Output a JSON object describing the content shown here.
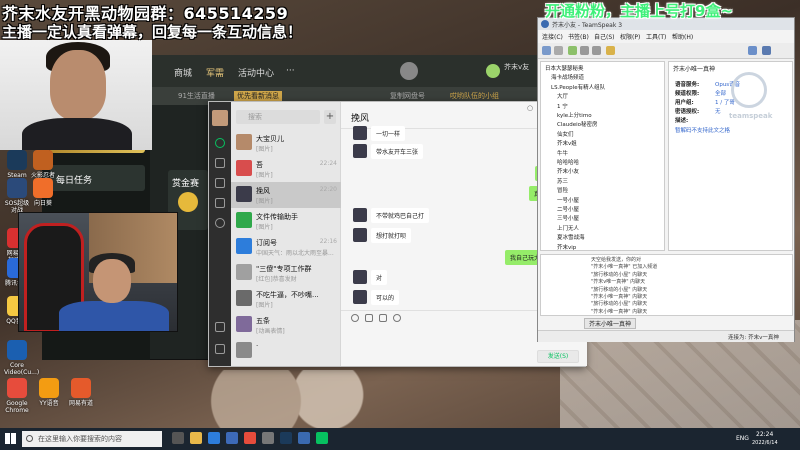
{
  "captions": {
    "top_left_1": "芥末水友开黑动物园群：645514259",
    "top_left_2": "主播一定认真看弹幕，回复每一条互动信息！",
    "top_right": "开通粉粉，主播上号打9盒~"
  },
  "game_client": {
    "nav": [
      "商城",
      "军需",
      "活动中心",
      "···"
    ],
    "sub_bar": [
      "优先看新消息",
      "91生活直播",
      "复制网盘号",
      "哎哟队伍的小组"
    ],
    "daily_task": "每日任务",
    "reward": "赏金赛",
    "player_name": "芥末v友",
    "badge": "每日在线"
  },
  "desktop_icons": [
    {
      "label": "Steam",
      "color": "#1b3a5a"
    },
    {
      "label": "SOS超级对战",
      "color": "#2b4a7a"
    },
    {
      "label": "网易UU加速器",
      "color": "#d83030"
    },
    {
      "label": "腾讯会议",
      "color": "#2a6ad8"
    },
    {
      "label": "QQ音乐",
      "color": "#f5c842"
    },
    {
      "label": "Core Video(Cu...)",
      "color": "#1b5fb0"
    },
    {
      "label": "Google Chrome",
      "color": "#e74c3c"
    },
    {
      "label": "YY语音",
      "color": "#f39c12"
    },
    {
      "label": "网易有道",
      "color": "#e55a2b"
    },
    {
      "label": "火影忍者",
      "color": "#c06020"
    },
    {
      "label": "向日葵",
      "color": "#f06e2a"
    }
  ],
  "wechat": {
    "search_placeholder": "搜索",
    "chats": [
      {
        "name": "大宝贝儿",
        "preview": "[图片]",
        "time": "",
        "color": "#b58a6a"
      },
      {
        "name": "吾",
        "preview": "[图片]",
        "time": "22:24",
        "color": "#d84d4d"
      },
      {
        "name": "挽风",
        "preview": "[图片]",
        "time": "22:20",
        "color": "#3b3b4a"
      },
      {
        "name": "文件传输助手",
        "preview": "[图片]",
        "time": "",
        "color": "#2fa84a"
      },
      {
        "name": "订阅号",
        "preview": "中国天气：雨以北大雨至暴...",
        "time": "22:16",
        "color": "#2d7ddb"
      },
      {
        "name": "\"三傻\"专项工作群",
        "preview": "[红包]恭喜发财",
        "time": "",
        "color": "#a0a0a0"
      },
      {
        "name": "不吃牛逼，不吵嘴...",
        "preview": "[图片]",
        "time": "",
        "color": "#6a6a6a"
      },
      {
        "name": "五条",
        "preview": "[动画表情]",
        "time": "",
        "color": "#7f6a9a"
      },
      {
        "name": "·",
        "preview": "",
        "time": "",
        "color": "#8a8a8a"
      }
    ],
    "active_title": "挽风",
    "messages": [
      {
        "dir": "in",
        "text": "一切一样"
      },
      {
        "dir": "in",
        "text": "带水友开车三张"
      },
      {
        "dir": "out",
        "text": "不行了"
      },
      {
        "dir": "out",
        "text": "真几把难"
      },
      {
        "dir": "in",
        "text": "不带就鸡巴自己打"
      },
      {
        "dir": "in",
        "text": "想打就打呗"
      },
      {
        "dir": "out",
        "text": "我自己玩大号去了"
      },
      {
        "dir": "in",
        "text": "对"
      },
      {
        "dir": "in",
        "text": "可以的"
      }
    ],
    "send_label": "发送(S)",
    "window_buttons": [
      "○",
      "–",
      "□",
      "×"
    ]
  },
  "teamspeak": {
    "title": "芥末小友 - TeamSpeak 3",
    "menu": [
      "连接(C)",
      "书签(B)",
      "自己(S)",
      "权限(P)",
      "工具(T)",
      "帮助(H)"
    ],
    "tree": [
      "日本大瑟瑟秘奥",
      "海卡战场频道",
      "LS.People有精人组队",
      "大厅",
      "1 宁",
      "kyle上分timo",
      "Claudeio秘密房",
      "仙女们",
      "芥末v姐",
      "牛牛",
      "哈哈哈哈",
      "芥末小友",
      "苏三",
      "冒险",
      "一号小屋",
      "二号小屋",
      "三号小屋",
      "上门无人",
      "夏冰雪战海",
      "芥末vip"
    ],
    "info_header": "芥末小唯一真神",
    "info": [
      {
        "k": "语音服务:",
        "v": "Opus语音"
      },
      {
        "k": "频道权限:",
        "v": "全部"
      },
      {
        "k": "用户组:",
        "v": "1 / 了哥"
      },
      {
        "k": "密语授权:",
        "v": "无"
      },
      {
        "k": "描述:",
        "v": ""
      }
    ],
    "info_note": "暂解码不支持此文之格",
    "logo_text": "teamspeak",
    "log_lines": [
      "天空给我发送，你的对",
      "\"芥末小唯一真神\" 已加入频道",
      "\"旅行移动的小屋\" 内聊天",
      "\"芥末v唯一真神\" 内聊天",
      "\"旅行移动的小屋\" 内聊天",
      "\"芥末小唯一真神\" 内聊天",
      "\"旅行移动的小屋\" 内聊天",
      "\"芥末小唯一真神\" 内聊天"
    ],
    "tabs": [
      "芥末小唯一真神"
    ],
    "status": {
      "left": "连接地址: 芥末小友",
      "right": "连接为: 芥末v一真神"
    }
  },
  "taskbar": {
    "search_placeholder": "在这里输入你要搜索的内容",
    "tray_lang": "ENG",
    "time": "22:24",
    "date": "2022/6/14"
  }
}
